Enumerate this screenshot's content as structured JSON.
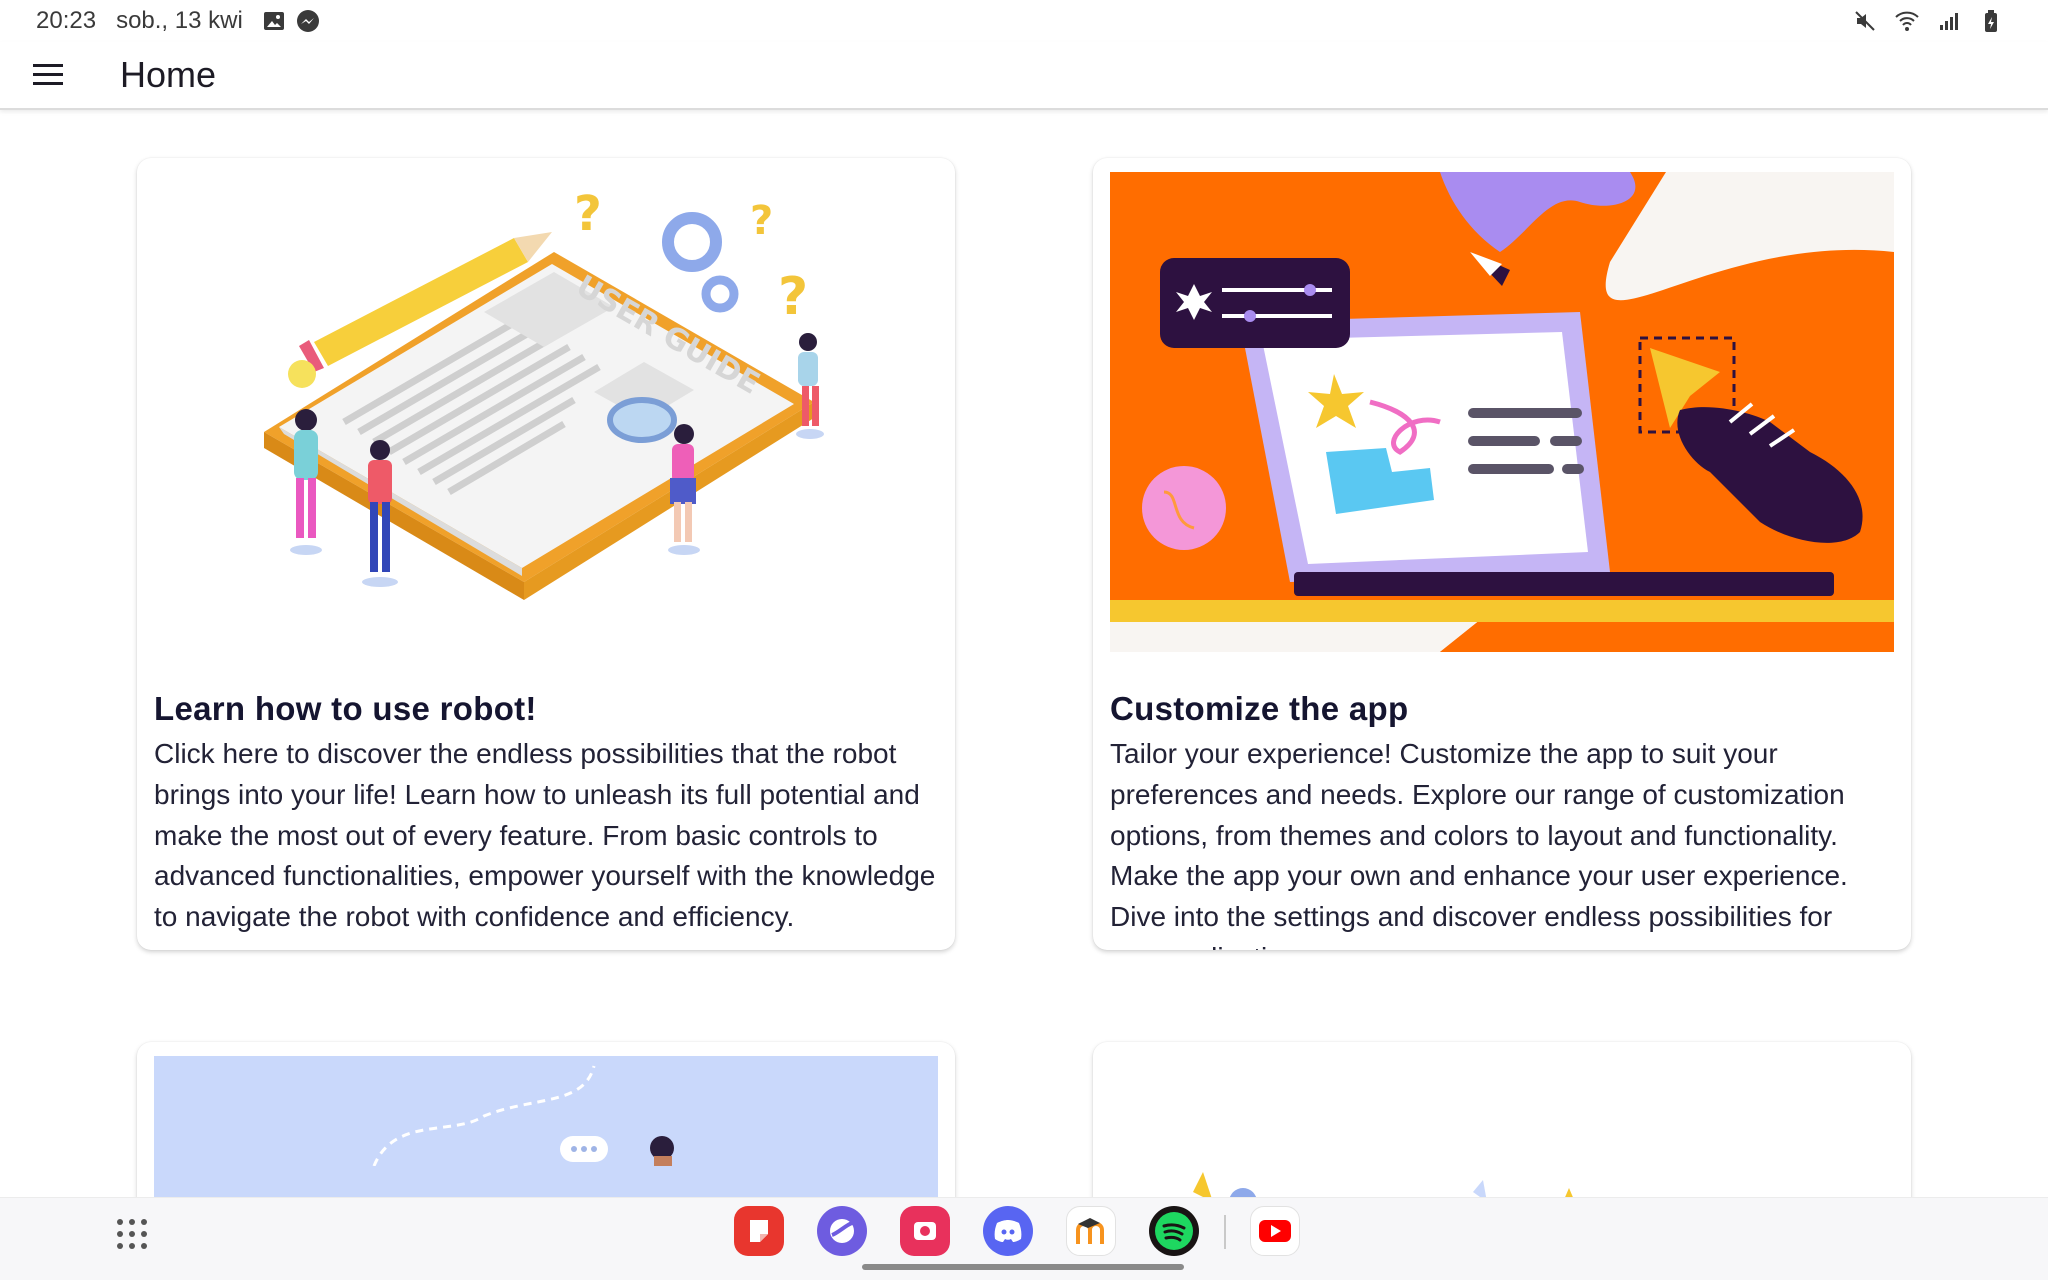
{
  "status_bar": {
    "time": "20:23",
    "date": "sob., 13 kwi",
    "left_icons": [
      "gallery-notification-icon",
      "messenger-notification-icon"
    ],
    "right_icons": [
      "mute-icon",
      "wifi-icon",
      "signal-icon",
      "battery-icon"
    ]
  },
  "app_bar": {
    "menu_icon": "hamburger-menu-icon",
    "title": "Home"
  },
  "cards": [
    {
      "title": "Learn how to use robot!",
      "text": "Click here to discover the endless possibilities that the robot brings into your life! Learn how to unleash its full potential and make the most out of every feature. From basic controls to advanced functionalities, empower yourself with the knowledge to navigate the robot with confidence and efficiency.",
      "illustration": "user-guide-illustration",
      "illustration_label": "USER GUIDE"
    },
    {
      "title": "Customize the app",
      "text": "Tailor your experience! Customize the app to suit your preferences and needs. Explore our range of customization options, from themes and colors to layout and functionality. Make the app your own and enhance your user experience. Dive into the settings and discover endless possibilities for personalization.",
      "illustration": "customize-app-illustration"
    }
  ],
  "dock": {
    "apps": [
      "notes-app",
      "browser-app",
      "screen-recorder-app",
      "discord-app",
      "moodle-app",
      "spotify-app",
      "youtube-app"
    ],
    "colors": {
      "accent_orange": "#ff6d00",
      "accent_purple": "#2d1140",
      "card_title": "#151530"
    }
  }
}
